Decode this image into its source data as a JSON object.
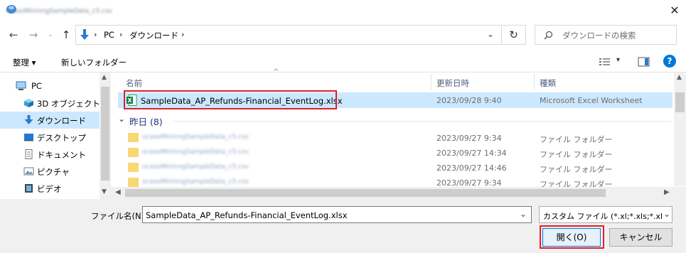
{
  "window": {
    "close_glyph": "✕"
  },
  "address": {
    "crumbs": [
      "PC",
      "ダウンロード"
    ],
    "search_placeholder": "ダウンロードの検索"
  },
  "toolbar": {
    "organize_label": "整理 ▾",
    "new_folder_label": "新しいフォルダー",
    "help_glyph": "?"
  },
  "nav": {
    "items": [
      {
        "label": "PC",
        "icon": "computer-icon"
      },
      {
        "label": "3D オブジェクト",
        "icon": "cube-icon"
      },
      {
        "label": "ダウンロード",
        "icon": "download-icon"
      },
      {
        "label": "デスクトップ",
        "icon": "desktop-icon"
      },
      {
        "label": "ドキュメント",
        "icon": "document-icon"
      },
      {
        "label": "ピクチャ",
        "icon": "picture-icon"
      },
      {
        "label": "ビデオ",
        "icon": "video-icon"
      }
    ]
  },
  "list": {
    "headers": {
      "name": "名前",
      "modified": "更新日時",
      "type": "種類"
    },
    "selected_file": {
      "name": "SampleData_AP_Refunds-Financial_EventLog.xlsx",
      "modified": "2023/09/28 9:40",
      "type": "Microsoft Excel Worksheet"
    },
    "group": {
      "label": "昨日 (8)"
    },
    "folders": [
      {
        "modified": "2023/09/27 9:34",
        "type": "ファイル フォルダー"
      },
      {
        "modified": "2023/09/27 14:34",
        "type": "ファイル フォルダー"
      },
      {
        "modified": "2023/09/27 14:46",
        "type": "ファイル フォルダー"
      },
      {
        "modified": "2023/09/27 9:34",
        "type": "ファイル フォルダー"
      }
    ]
  },
  "footer": {
    "filename_label": "ファイル名(N):",
    "filename_value": "SampleData_AP_Refunds-Financial_EventLog.xlsx",
    "filter_value": "カスタム ファイル (*.xl;*.xls;*.xlsb;*.",
    "open_label": "開く(O)",
    "cancel_label": "キャンセル"
  },
  "colors": {
    "selection": "#cce8ff",
    "highlight": "#e0202a",
    "accent": "#0078d7"
  }
}
